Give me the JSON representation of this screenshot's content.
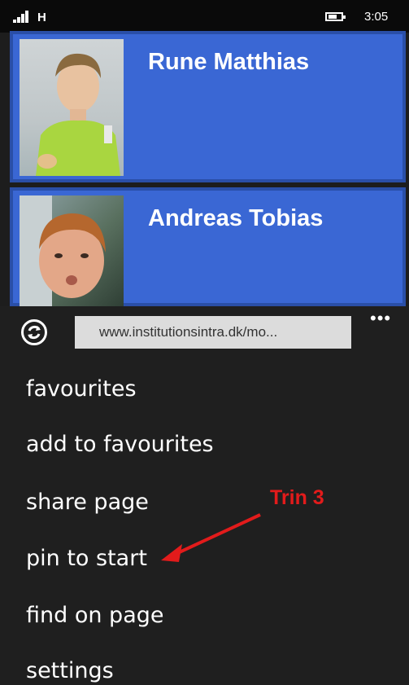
{
  "status_bar": {
    "network": "H",
    "time": "3:05",
    "signal_icon": "signal-bars-icon",
    "battery_icon": "battery-icon"
  },
  "tiles": [
    {
      "name": "Rune Matthias",
      "photo": "child-photo"
    },
    {
      "name": "Andreas Tobias",
      "photo": "child-photo"
    }
  ],
  "app_bar": {
    "refresh_icon": "refresh-icon",
    "url": "www.institutionsintra.dk/mo...",
    "more_label": "•••",
    "menu": [
      "favourites",
      "add to favourites",
      "share page",
      "pin to start",
      "find on page",
      "settings"
    ]
  },
  "annotation": {
    "label": "Trin 3",
    "color": "#e21b1b"
  },
  "colors": {
    "tile": "#3a67d4",
    "tile_border": "#2a4fa8",
    "app_bar": "#1f1f1f",
    "status_bar": "#0a0a0a"
  }
}
